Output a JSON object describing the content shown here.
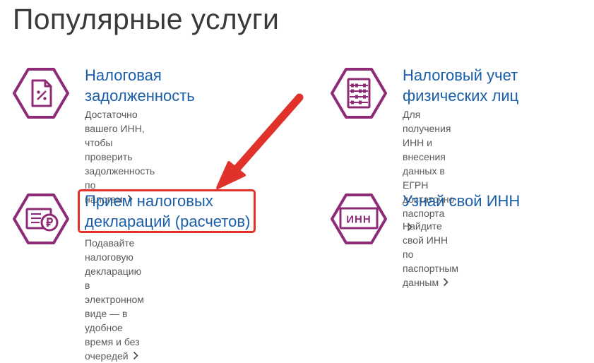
{
  "page": {
    "title": "Популярные услуги"
  },
  "services": [
    {
      "title_lines": [
        "Налоговая",
        "задолженность"
      ],
      "desc_lines": [
        "Достаточно вашего ИНН, чтобы",
        "проверить задолженность по",
        "налогам"
      ],
      "icon": "tax-debt-document-icon"
    },
    {
      "title_lines": [
        "Налоговый учет",
        "физических лиц"
      ],
      "desc_lines": [
        "Для получения ИНН и внесения",
        "данных в ЕГРН достаточно",
        "паспорта"
      ],
      "icon": "abacus-icon"
    },
    {
      "title_lines": [
        "Прием налоговых",
        "деклараций (расчетов)"
      ],
      "desc_lines": [
        "Подавайте налоговую декларацию",
        "в электронном виде — в удобное",
        "время и без очередей"
      ],
      "icon": "ruble-declaration-icon"
    },
    {
      "title_lines": [
        "Узнай свой ИНН"
      ],
      "desc_lines": [
        "Найдите свой ИНН по паспортным",
        "данным"
      ],
      "icon": "inn-card-icon",
      "icon_text": "ИНН"
    }
  ],
  "colors": {
    "icon_purple": "#8e2b77",
    "link_blue": "#1a5ea8",
    "description_gray": "#5a5a5a",
    "title_dark": "#3a3a3a",
    "annotation_red": "#e0312b"
  }
}
